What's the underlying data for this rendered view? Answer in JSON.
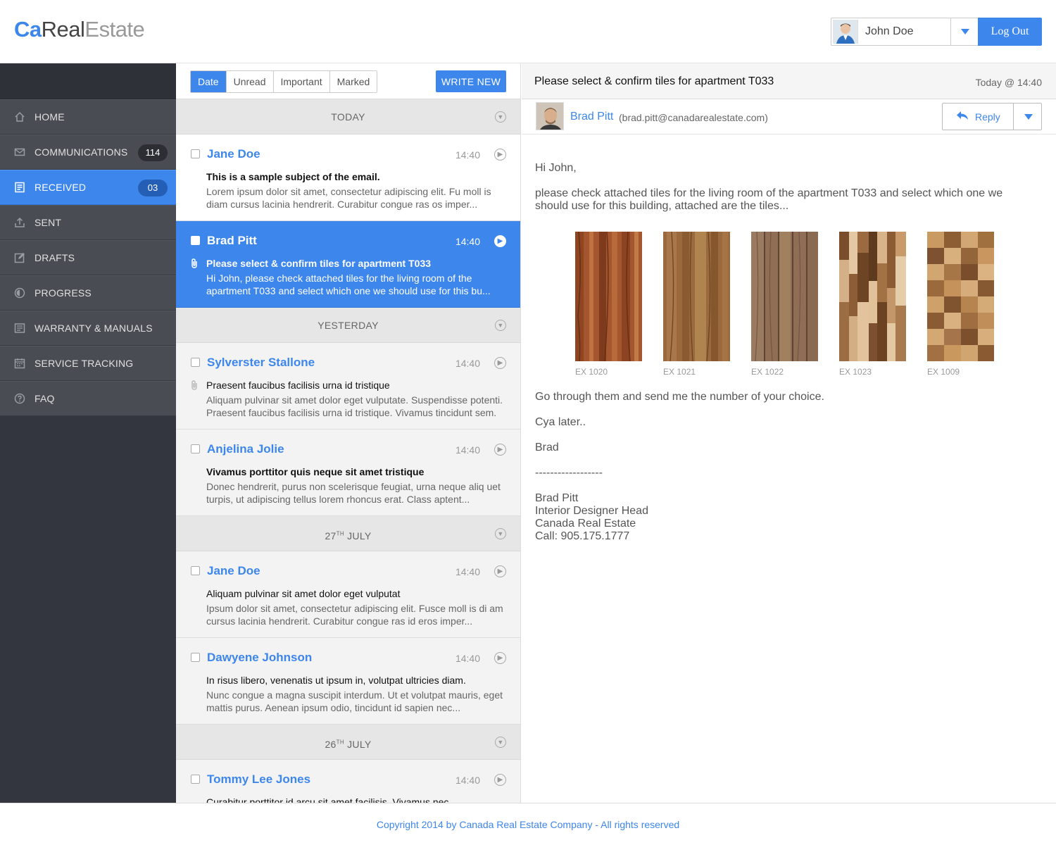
{
  "header": {
    "logo_ca": "Ca",
    "logo_real": "Real",
    "logo_estate": "Estate",
    "user_name": "John Doe",
    "logout_label": "Log Out"
  },
  "sidebar": {
    "items": [
      {
        "label": "HOME",
        "icon": "home-icon"
      },
      {
        "label": "COMMUNICATIONS",
        "icon": "envelope-icon",
        "badge": "114"
      },
      {
        "label": "RECEIVED",
        "icon": "inbox-icon",
        "badge": "03",
        "active": true
      },
      {
        "label": "SENT",
        "icon": "upload-icon"
      },
      {
        "label": "DRAFTS",
        "icon": "edit-icon"
      },
      {
        "label": "PROGRESS",
        "icon": "progress-icon"
      },
      {
        "label": "WARRANTY & MANUALS",
        "icon": "document-icon"
      },
      {
        "label": "SERVICE TRACKING",
        "icon": "calendar-icon"
      },
      {
        "label": "FAQ",
        "icon": "question-icon"
      }
    ]
  },
  "list": {
    "filters": [
      "Date",
      "Unread",
      "Important",
      "Marked"
    ],
    "write_new": "WRITE NEW",
    "groups": {
      "today": "TODAY",
      "yesterday": "YESTERDAY",
      "jul27_day": "27",
      "jul27_sup": "TH",
      "jul27_month": " JULY",
      "jul26_day": "26",
      "jul26_sup": "TH",
      "jul26_month": " JULY"
    },
    "mails": [
      {
        "from": "Jane Doe",
        "time": "14:40",
        "subject": "This is a sample subject of the email.",
        "preview": "Lorem ipsum dolor sit amet, consectetur adipiscing elit. Fu moll is diam cursus lacinia hendrerit. Curabitur congue ras os imper..."
      },
      {
        "from": "Brad Pitt",
        "time": "14:40",
        "subject": "Please select & confirm tiles for apartment T033",
        "preview": "Hi John, please check attached tiles for the living room of the apartment T033 and select which one we should use for this bu..."
      },
      {
        "from": "Sylverster Stallone",
        "time": "14:40",
        "subject": "Praesent faucibus facilisis urna id tristique",
        "preview": "Aliquam pulvinar sit amet dolor eget vulputate. Suspendisse potenti. Praesent faucibus facilisis urna id tristique. Vivamus tincidunt sem."
      },
      {
        "from": "Anjelina Jolie",
        "time": "14:40",
        "subject": "Vivamus porttitor quis neque sit amet tristique",
        "preview": "Donec hendrerit, purus non scelerisque feugiat, urna neque aliq uet turpis, ut adipiscing tellus lorem rhoncus erat. Class aptent..."
      },
      {
        "from": "Jane Doe",
        "time": "14:40",
        "subject": "Aliquam pulvinar sit amet dolor eget vulputat",
        "preview": "Ipsum dolor sit amet, consectetur adipiscing elit. Fusce moll is di am cursus lacinia hendrerit. Curabitur congue ras id eros imper..."
      },
      {
        "from": "Dawyene Johnson",
        "time": "14:40",
        "subject": "In risus libero, venenatis ut ipsum in, volutpat ultricies diam.",
        "preview": "Nunc congue a magna suscipit interdum. Ut et volutpat mauris, eget mattis purus. Aenean ipsum odio, tincidunt id sapien nec..."
      },
      {
        "from": "Tommy Lee Jones",
        "time": "14:40",
        "subject": "Curabitur porttitor id arcu sit amet facilisis. Vivamus nec",
        "preview": ""
      }
    ]
  },
  "reader": {
    "subject": "Please select & confirm tiles for apartment T033",
    "date": "Today @ 14:40",
    "sender_name": "Brad Pitt",
    "sender_email": "(brad.pitt@canadarealestate.com)",
    "reply_label": "Reply",
    "greeting": "Hi John,",
    "paragraph1": "please check attached tiles for the living room of the apartment T033 and select which one we should use for this building, attached are the tiles...",
    "tiles": [
      "EX 1020",
      "EX 1021",
      "EX 1022",
      "EX 1023",
      "EX 1009"
    ],
    "paragraph2": "Go through them and send me the number of your choice.",
    "paragraph3": "Cya later..",
    "signoff": "Brad",
    "separator": "------------------",
    "sig_name": "Brad Pitt",
    "sig_title": "Interior Designer Head",
    "sig_company": "Canada Real Estate",
    "sig_phone": "Call: 905.175.1777"
  },
  "footer": {
    "text": "Copyright 2014 by Canada Real Estate Company - All rights reserved"
  },
  "colors": {
    "accent": "#3d86ec",
    "sidebar_bg": "#34363f",
    "sidebar_item": "#4a4c53"
  }
}
